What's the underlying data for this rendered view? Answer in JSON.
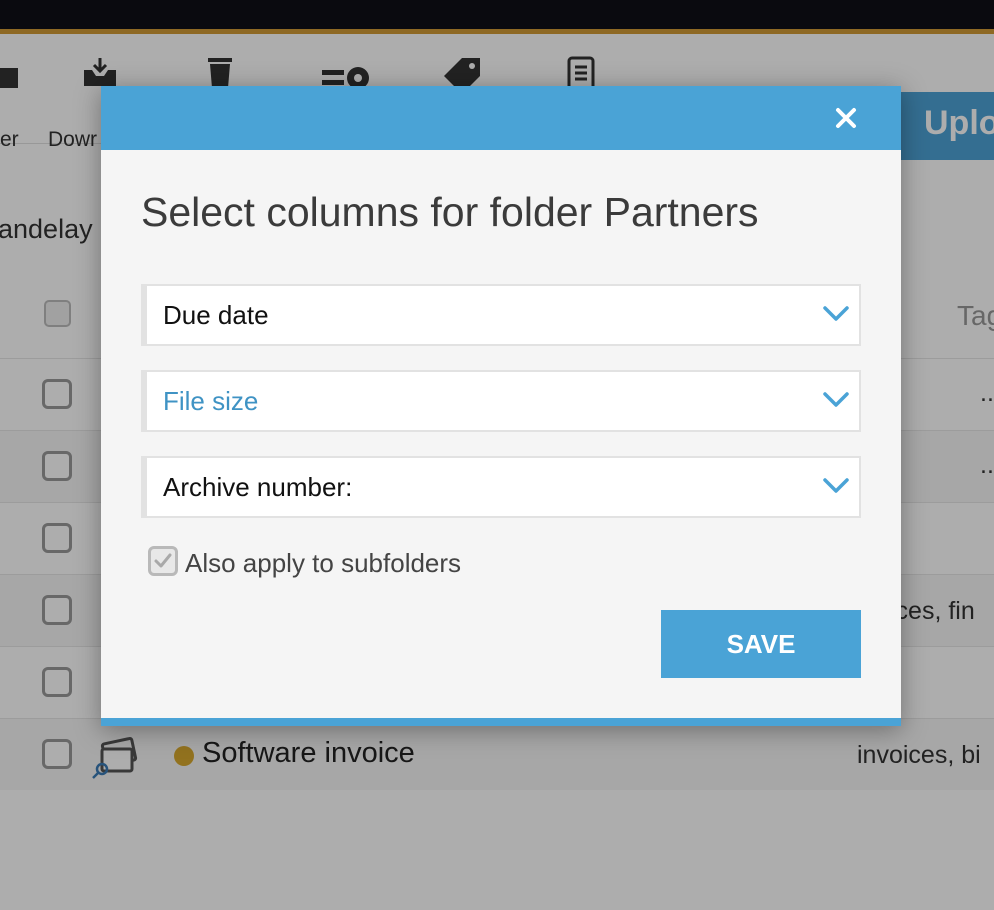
{
  "app": {
    "toolbar": {
      "items": [
        {
          "label": "er",
          "icon": "folder-icon"
        },
        {
          "label": "Dowr",
          "icon": "download-icon"
        },
        {
          "label": "",
          "icon": "trash-icon"
        },
        {
          "label": "",
          "icon": "settings-icon"
        },
        {
          "label": "",
          "icon": "tag-icon"
        },
        {
          "label": "",
          "icon": "document-icon"
        }
      ],
      "upload_label": "Uplo"
    },
    "breadcrumb": "andelay",
    "table": {
      "tag_header": "Tag",
      "rows": [
        {
          "title": "",
          "tags": "..",
          "status_color": ""
        },
        {
          "title": "",
          "tags": "..",
          "status_color": ""
        },
        {
          "title": "",
          "tags": "",
          "status_color": ""
        },
        {
          "title": "",
          "tags": "ices, fin",
          "status_color": ""
        },
        {
          "title": "",
          "tags": "",
          "status_color": ""
        },
        {
          "title": "Software invoice",
          "tags": "invoices, bi",
          "status_color": "#d7a92e"
        }
      ]
    }
  },
  "modal": {
    "title": "Select columns for folder Partners",
    "close_icon": "close-icon",
    "selects": [
      {
        "value": "Due date"
      },
      {
        "value": "File size"
      },
      {
        "value": "Archive number:"
      }
    ],
    "subfolders_label": "Also apply to subfolders",
    "subfolders_checked": true,
    "save_label": "SAVE"
  },
  "colors": {
    "accent": "#4aa3d6",
    "topbar": "#101017",
    "topbar_accent": "#d19b35",
    "status_dot": "#d7a92e"
  }
}
